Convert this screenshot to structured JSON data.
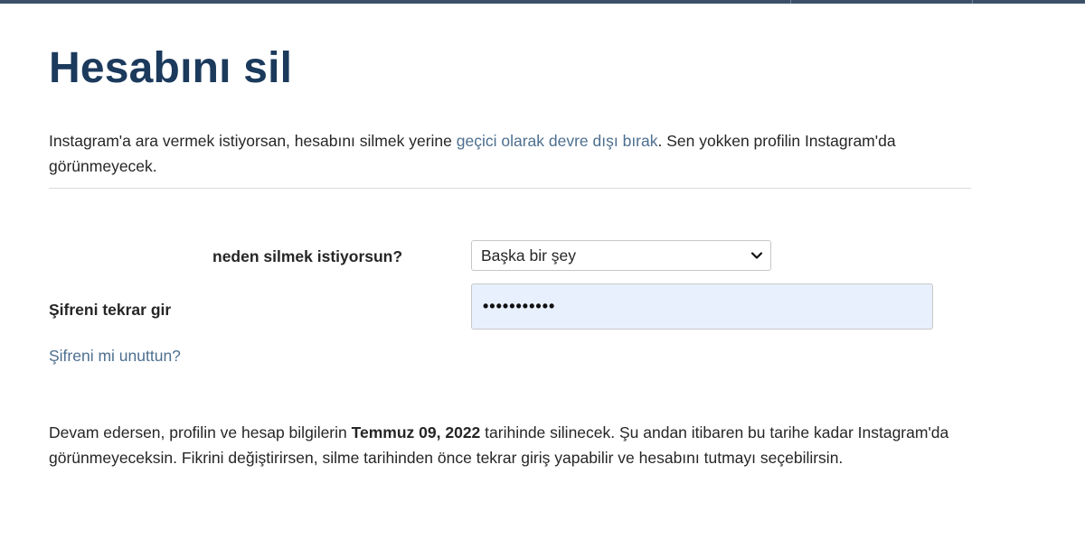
{
  "page": {
    "title": "Hesabını sil"
  },
  "intro": {
    "text_before": "Instagram'a ara vermek istiyorsan, hesabını silmek yerine ",
    "link_text": "geçici olarak devre dışı bırak",
    "text_after": ". Sen yokken profilin Instagram'da görünmeyecek."
  },
  "form": {
    "reason_label": "neden silmek istiyorsun?",
    "reason_selected": "Başka bir şey",
    "password_label": "Şifreni tekrar gir",
    "password_value_masked": "•••••••••••",
    "forgot_link": "Şifreni mi unuttun?"
  },
  "notice": {
    "text_before": "Devam edersen, profilin ve hesap bilgilerin ",
    "date": "Temmuz 09, 2022",
    "text_after": " tarihinde silinecek. Şu andan itibaren bu tarihe kadar Instagram'da görünmeyeceksin. Fikrini değiştirirsen, silme tarihinden önce tekrar giriş yapabilir ve hesabını tutmayı seçebilirsin."
  },
  "colors": {
    "title": "#1b3a5c",
    "link": "#4d6f8f",
    "autofill_bg": "#e8f0fe",
    "top_bar": "#3b5067"
  },
  "icons": {
    "select_arrow": "chevron-down-icon"
  }
}
